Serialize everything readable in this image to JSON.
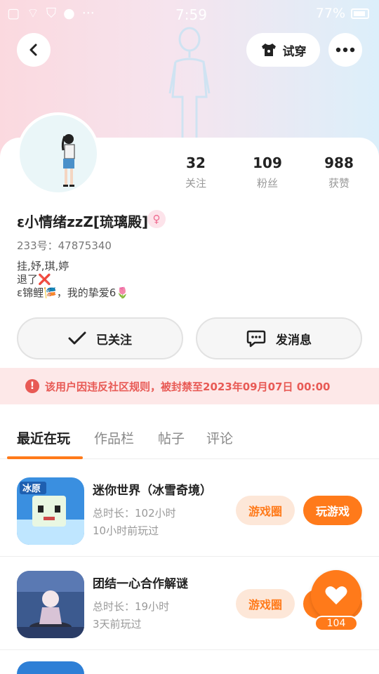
{
  "status_bar": {
    "time": "7:59",
    "battery": "77%"
  },
  "header": {
    "tryon_label": "试穿"
  },
  "stats": [
    {
      "value": "32",
      "label": "关注"
    },
    {
      "value": "109",
      "label": "粉丝"
    },
    {
      "value": "988",
      "label": "获赞"
    }
  ],
  "profile": {
    "name": "ε小情绪zzZ[琉璃殿]",
    "gender_symbol": "♀",
    "id_line": "233号：47875340",
    "bio": [
      "挂,妤,琪,婷",
      "退了❌",
      "ε锦鲤🎏，我的挚爱6🌷"
    ]
  },
  "actions": {
    "followed_label": "已关注",
    "message_label": "发消息"
  },
  "ban_notice": "该用户因违反社区规则，被封禁至2023年09月07日 00:00",
  "tabs": [
    "最近在玩",
    "作品栏",
    "帖子",
    "评论"
  ],
  "games": [
    {
      "title": "迷你世界（冰雪奇境）",
      "duration": "总时长：102小时",
      "last_played": "10小时前玩过",
      "circle_label": "游戏圈",
      "play_label": "玩游戏"
    },
    {
      "title": "团结一心合作解谜",
      "duration": "总时长：19小时",
      "last_played": "3天前玩过",
      "circle_label": "游戏圈",
      "play_label": "玩游戏"
    }
  ],
  "like_count": "104",
  "colors": {
    "accent": "#ff7a1a",
    "ban_text": "#e85a55",
    "ban_bg": "#fde8e8"
  }
}
